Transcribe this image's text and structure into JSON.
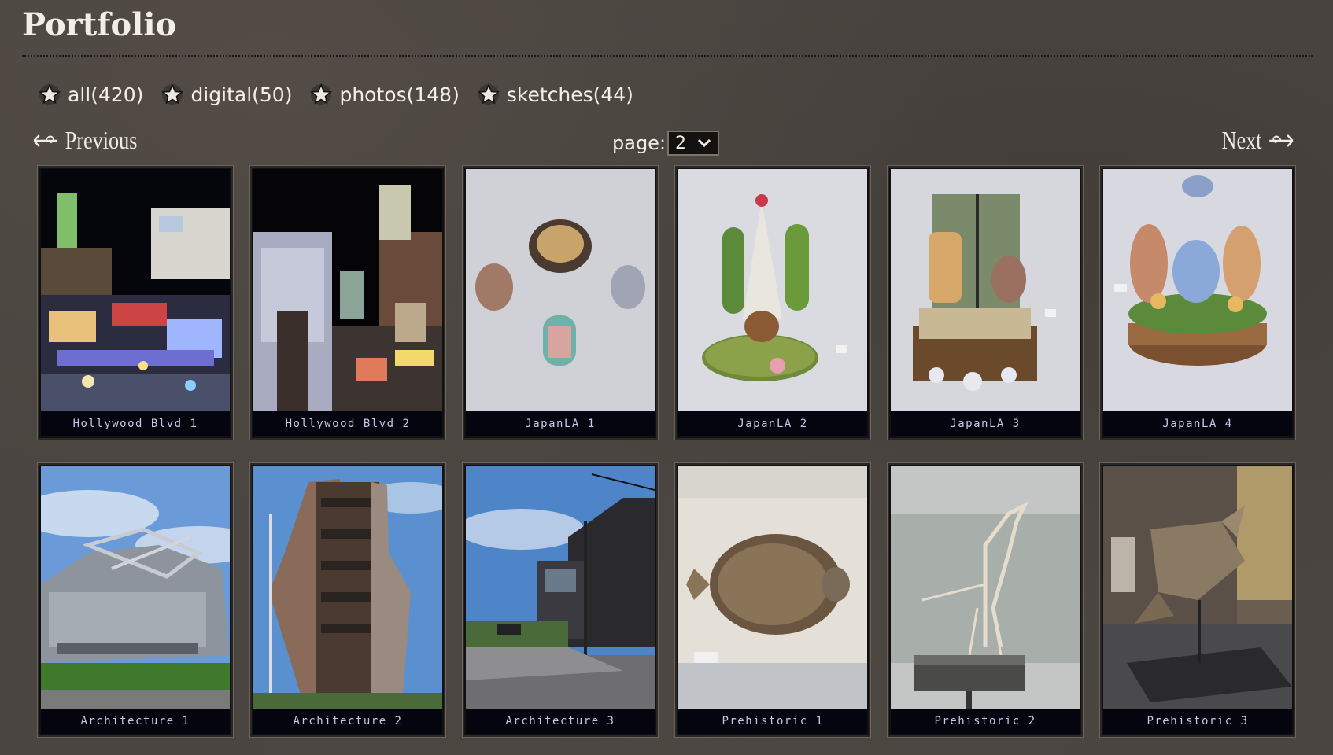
{
  "page": {
    "title": "Portfolio"
  },
  "filters": [
    {
      "label": "all(420)"
    },
    {
      "label": "digital(50)"
    },
    {
      "label": "photos(148)"
    },
    {
      "label": "sketches(44)"
    }
  ],
  "pager": {
    "previous_label": "Previous",
    "next_label": "Next",
    "page_label": "page:",
    "page_value": "2"
  },
  "gallery": [
    {
      "caption": "Hollywood Blvd 1"
    },
    {
      "caption": "Hollywood Blvd 2"
    },
    {
      "caption": "JapanLA 1"
    },
    {
      "caption": "JapanLA 2"
    },
    {
      "caption": "JapanLA 3"
    },
    {
      "caption": "JapanLA 4"
    },
    {
      "caption": "Architecture 1"
    },
    {
      "caption": "Architecture 2"
    },
    {
      "caption": "Architecture 3"
    },
    {
      "caption": "Prehistoric 1"
    },
    {
      "caption": "Prehistoric 2"
    },
    {
      "caption": "Prehistoric 3"
    }
  ]
}
